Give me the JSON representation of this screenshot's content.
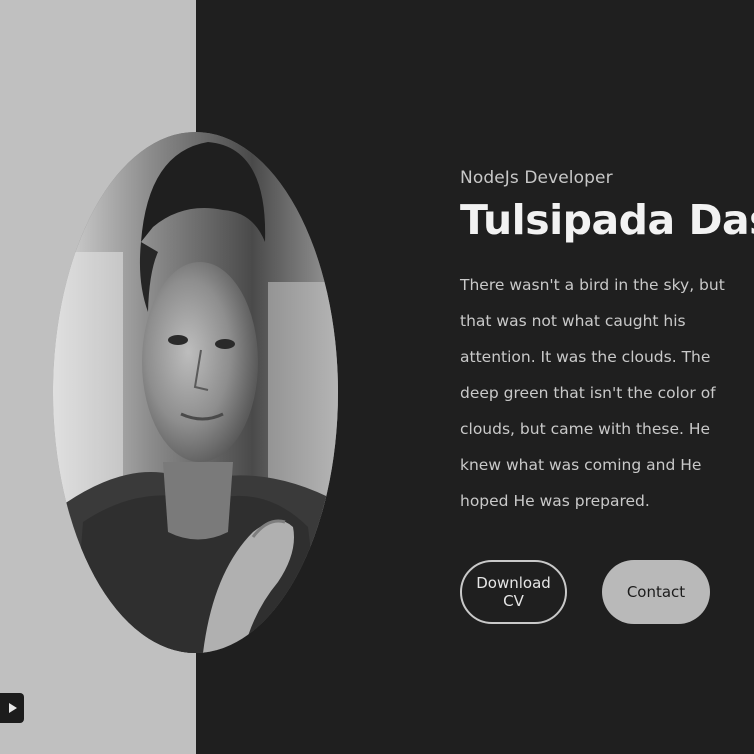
{
  "hero": {
    "role": "NodeJs Developer",
    "name": "Tulsipada Das",
    "bio": "There wasn't a bird in the sky, but that was not what caught his attention. It was the clouds. The deep green that isn't the color of clouds, but came with these. He knew what was coming and He hoped He was prepared."
  },
  "buttons": {
    "download_cv": "Download CV",
    "contact": "Contact"
  },
  "portrait": {
    "alt": "grayscale portrait photo"
  },
  "icons": {
    "play": "play-icon"
  },
  "colors": {
    "left_bg": "#c0c0c0",
    "right_bg": "#1f1f1f",
    "accent": "#b9b9b9"
  }
}
